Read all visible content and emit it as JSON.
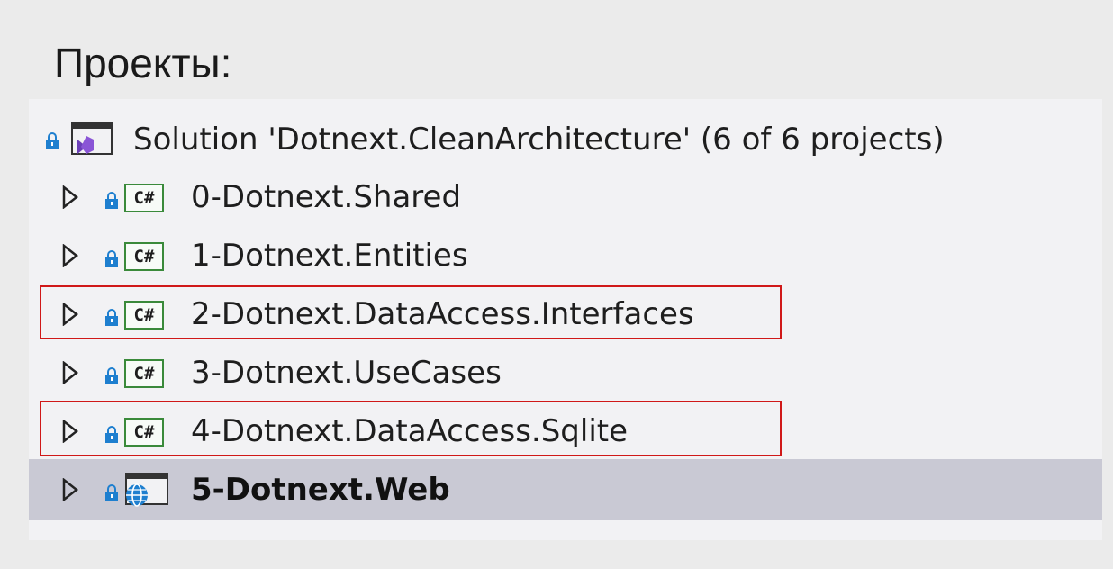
{
  "heading": "Проекты:",
  "solution": {
    "label": "Solution 'Dotnext.CleanArchitecture' (6 of 6 projects)",
    "icon": "visual-studio-solution-icon"
  },
  "projects": [
    {
      "label": "0-Dotnext.Shared",
      "icon": "csharp-project-icon",
      "highlighted": false
    },
    {
      "label": "1-Dotnext.Entities",
      "icon": "csharp-project-icon",
      "highlighted": false
    },
    {
      "label": "2-Dotnext.DataAccess.Interfaces",
      "icon": "csharp-project-icon",
      "highlighted": true
    },
    {
      "label": "3-Dotnext.UseCases",
      "icon": "csharp-project-icon",
      "highlighted": false
    },
    {
      "label": "4-Dotnext.DataAccess.Sqlite",
      "icon": "csharp-project-icon",
      "highlighted": true
    },
    {
      "label": "5-Dotnext.Web",
      "icon": "web-project-icon",
      "highlighted": false,
      "selected": true,
      "bold": true
    }
  ],
  "cs_icon_text": "C#",
  "colors": {
    "highlight_border": "#d01818",
    "selected_row": "#c9c9d4",
    "lock": "#1e7fcf",
    "cs_border": "#3a8a3a"
  }
}
